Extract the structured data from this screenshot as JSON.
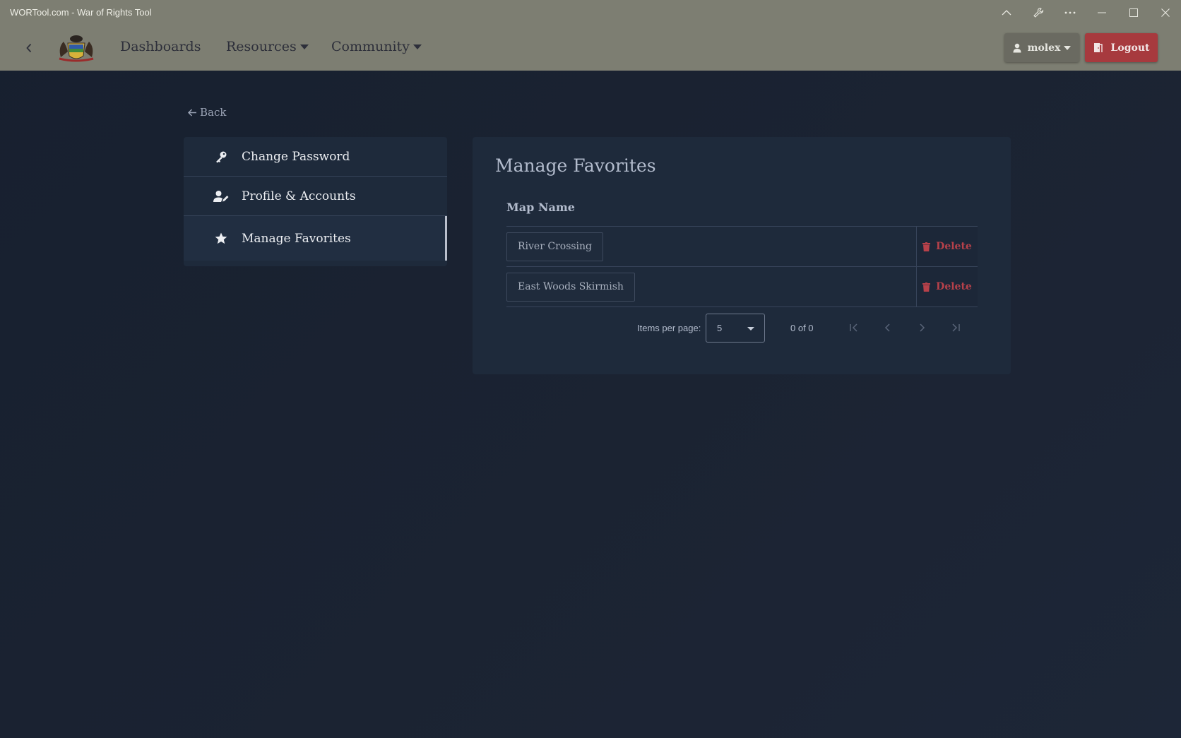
{
  "window": {
    "title": "WORTool.com - War of Rights Tool",
    "controls": [
      "chevron-up-icon",
      "wrench-icon",
      "more-icon",
      "minimize-icon",
      "maximize-icon",
      "close-icon"
    ]
  },
  "navbar": {
    "links": [
      {
        "label": "Dashboards",
        "dropdown": false
      },
      {
        "label": "Resources",
        "dropdown": true
      },
      {
        "label": "Community",
        "dropdown": true
      }
    ],
    "user_label": "molex",
    "logout_label": "Logout",
    "colors": {
      "bar": "#7d7e72",
      "logout": "#a73a3e",
      "user": "#6a6a61"
    }
  },
  "back_link": "Back",
  "sidebar": {
    "items": [
      {
        "label": "Change Password",
        "icon": "key-icon"
      },
      {
        "label": "Profile & Accounts",
        "icon": "user-edit-icon"
      },
      {
        "label": "Manage Favorites",
        "icon": "star-icon",
        "active": true
      }
    ]
  },
  "favorites": {
    "title": "Manage Favorites",
    "column_header": "Map Name",
    "rows": [
      {
        "name": "River Crossing",
        "action": "Delete"
      },
      {
        "name": "East Woods Skirmish",
        "action": "Delete"
      }
    ],
    "paginator": {
      "items_per_page_label": "Items per page:",
      "page_size": "5",
      "range_label": "0 of 0"
    }
  }
}
